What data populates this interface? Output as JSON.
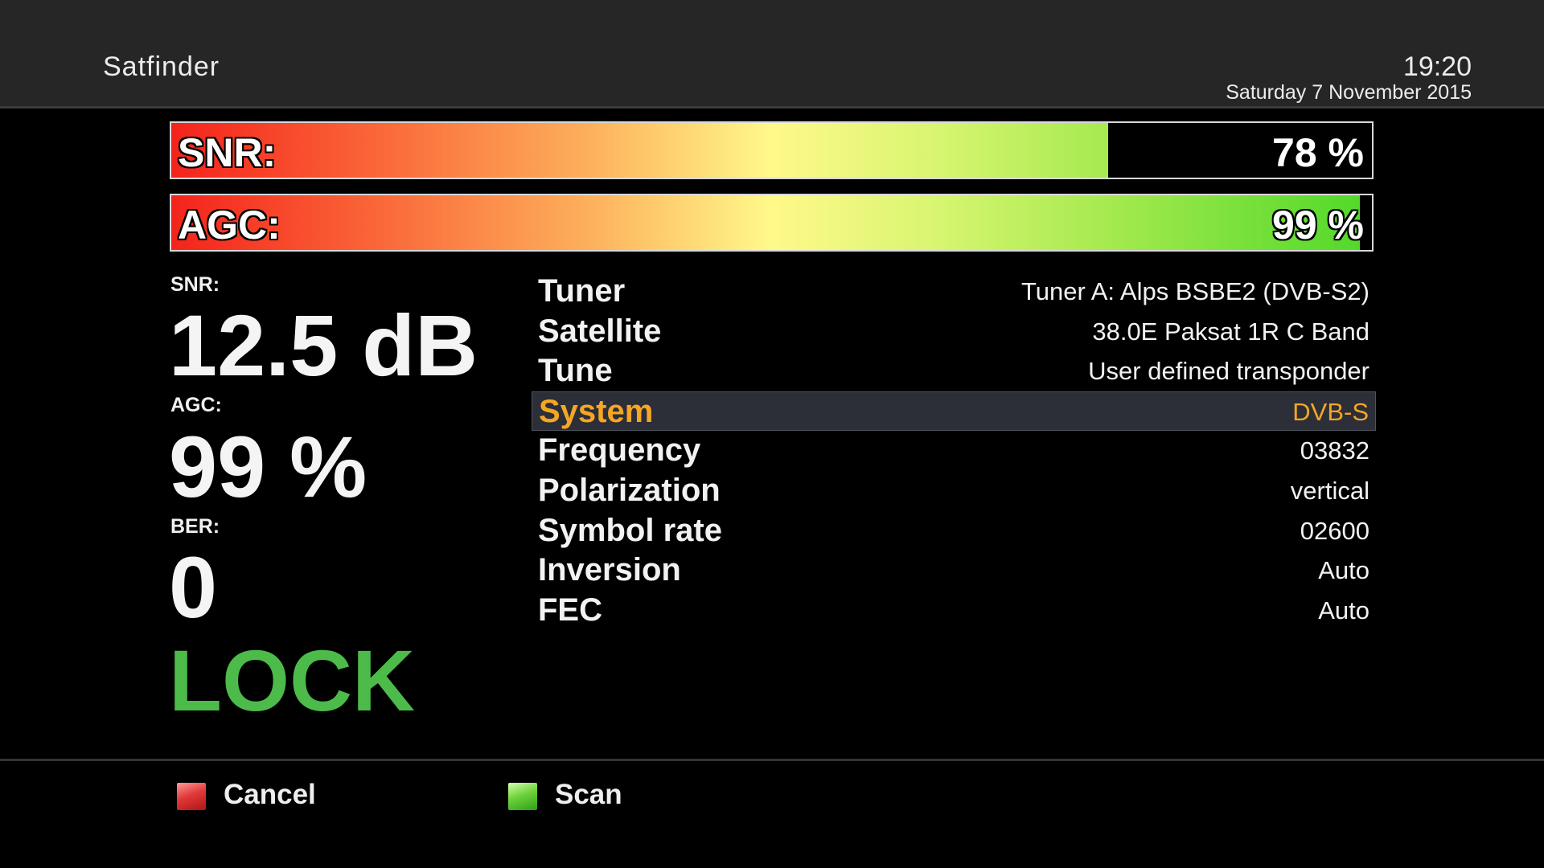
{
  "header": {
    "title": "Satfinder",
    "time": "19:20",
    "date": "Saturday  7 November 2015"
  },
  "bars": {
    "snr": {
      "label": "SNR:",
      "value_text": "78 %",
      "percent": 78
    },
    "agc": {
      "label": "AGC:",
      "value_text": "99 %",
      "percent": 99
    }
  },
  "stats": {
    "snr_label": "SNR:",
    "snr_value": "12.5 dB",
    "agc_label": "AGC:",
    "agc_value": "99 %",
    "ber_label": "BER:",
    "ber_value": "0",
    "lock_status": "LOCK"
  },
  "info": {
    "rows": [
      {
        "key": "Tuner",
        "value": "Tuner A: Alps BSBE2 (DVB-S2)"
      },
      {
        "key": "Satellite",
        "value": "38.0E Paksat 1R C Band"
      },
      {
        "key": "Tune",
        "value": "User defined transponder"
      },
      {
        "key": "System",
        "value": "DVB-S",
        "selected": true
      },
      {
        "key": "Frequency",
        "value": "03832"
      },
      {
        "key": "Polarization",
        "value": "vertical"
      },
      {
        "key": "Symbol rate",
        "value": "02600"
      },
      {
        "key": "Inversion",
        "value": "Auto"
      },
      {
        "key": "FEC",
        "value": "Auto"
      }
    ]
  },
  "footer": {
    "cancel_label": "Cancel",
    "cancel_icon": "red-key-icon",
    "scan_label": "Scan",
    "scan_icon": "green-key-icon"
  },
  "colors": {
    "selected_text": "#f5a623",
    "lock_green": "#4cbb4a",
    "header_bg": "#262626",
    "selected_row_bg": "#2c2e38"
  }
}
